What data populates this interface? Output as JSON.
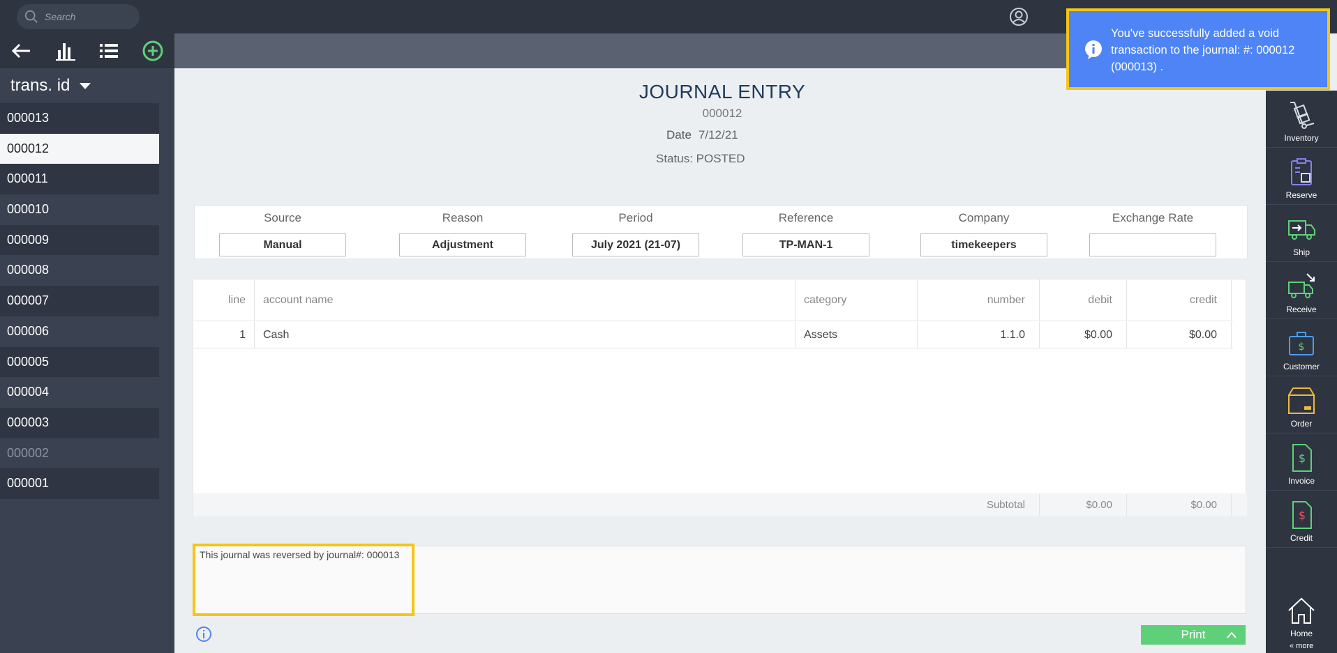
{
  "topbar": {
    "search_placeholder": "Search",
    "user_icon": "user-circle-icon"
  },
  "leftbar": {
    "toolbar_icons": [
      "back-arrow-icon",
      "bar-chart-icon",
      "list-icon",
      "add-circle-icon"
    ],
    "sort_label": "trans. id",
    "items": [
      {
        "id": "000013",
        "state": "normal"
      },
      {
        "id": "000012",
        "state": "selected"
      },
      {
        "id": "000011",
        "state": "normal"
      },
      {
        "id": "000010",
        "state": "normal"
      },
      {
        "id": "000009",
        "state": "normal"
      },
      {
        "id": "000008",
        "state": "normal"
      },
      {
        "id": "000007",
        "state": "normal"
      },
      {
        "id": "000006",
        "state": "normal"
      },
      {
        "id": "000005",
        "state": "normal"
      },
      {
        "id": "000004",
        "state": "normal"
      },
      {
        "id": "000003",
        "state": "normal"
      },
      {
        "id": "000002",
        "state": "muted"
      },
      {
        "id": "000001",
        "state": "normal"
      }
    ]
  },
  "journal": {
    "title": "JOURNAL ENTRY",
    "number": "000012",
    "date_label": "Date",
    "date_value": "7/12/21",
    "status": "Status: POSTED"
  },
  "meta": {
    "source_label": "Source",
    "source_value": "Manual",
    "reason_label": "Reason",
    "reason_value": "Adjustment",
    "period_label": "Period",
    "period_value": "July 2021 (21-07)",
    "reference_label": "Reference",
    "reference_value": "TP-MAN-1",
    "company_label": "Company",
    "company_value": "timekeepers",
    "exchange_label": "Exchange Rate",
    "exchange_value": ""
  },
  "lines": {
    "headers": {
      "line": "line",
      "account": "account name",
      "category": "category",
      "number": "number",
      "debit": "debit",
      "credit": "credit"
    },
    "rows": [
      {
        "line": "1",
        "account": "Cash",
        "category": "Assets",
        "number": "1.1.0",
        "debit": "$0.00",
        "credit": "$0.00"
      }
    ],
    "subtotal_label": "Subtotal",
    "subtotal_debit": "$0.00",
    "subtotal_credit": "$0.00"
  },
  "notes": {
    "text": "This journal was reversed by journal#: 000013"
  },
  "footer": {
    "print_label": "Print"
  },
  "rightbar": {
    "items": [
      {
        "label": "Inventory",
        "icon": "dolly-icon"
      },
      {
        "label": "Reserve",
        "icon": "clipboard-box-icon"
      },
      {
        "label": "Ship",
        "icon": "ship-truck-icon"
      },
      {
        "label": "Receive",
        "icon": "receive-truck-icon"
      },
      {
        "label": "Customer",
        "icon": "customer-briefcase-icon"
      },
      {
        "label": "Order",
        "icon": "order-box-icon"
      },
      {
        "label": "Invoice",
        "icon": "invoice-dollar-icon"
      },
      {
        "label": "Credit",
        "icon": "credit-dollar-icon"
      },
      {
        "label": "Home",
        "icon": "home-icon"
      }
    ],
    "more_label": "« more"
  },
  "toast": {
    "message": "You've successfully added a void transaction to the journal: #: 000012 (000013) ."
  },
  "colors": {
    "accent_green": "#5fd07a",
    "toast_blue": "#4e84f5",
    "highlight_yellow": "#f5c518",
    "title_navy": "#1f3a5f"
  }
}
